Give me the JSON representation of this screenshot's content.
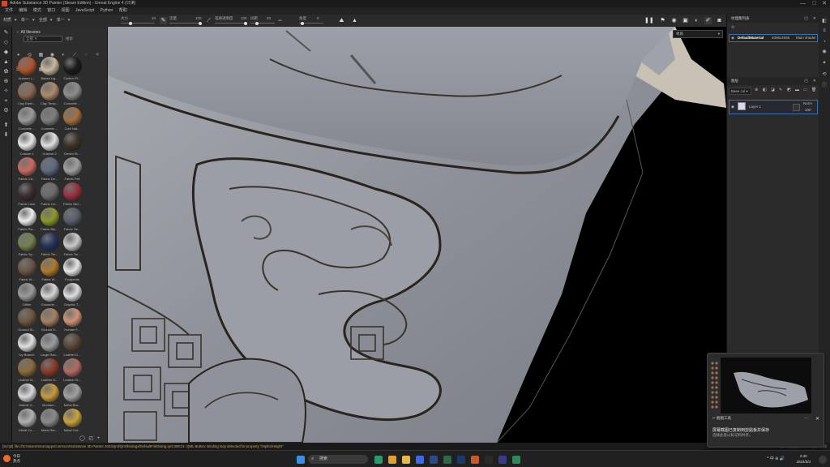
{
  "window": {
    "title": "Adobe Substance 3D Painter (Steam Edition) - Unreal Engine 4 (只读)",
    "controls": [
      "—",
      "□",
      "✕"
    ]
  },
  "menu": [
    "文件",
    "编辑",
    "模式",
    "窗口",
    "视图",
    "JavaScript",
    "Python",
    "帮助"
  ],
  "toolbar": [
    "材质",
    "▾",
    "单一",
    "▾",
    "全部",
    "▾",
    "单一",
    "▾",
    "全部",
    "▾"
  ],
  "properties": {
    "size_label": "大小",
    "size_value": "10",
    "flow_label": "流量",
    "flow_value": "100",
    "hardness_label": "笔刷透明度",
    "hardness_value": "100",
    "spacing_label": "间距",
    "spacing_value": "20",
    "angle_label": "角度",
    "angle_value": "0"
  },
  "assets": {
    "header": "All libraries",
    "search_placeholder": "搜索",
    "filter_tag": "全部",
    "items": [
      {
        "label": "Autumn L...",
        "color": "#b0542b"
      },
      {
        "label": "Baked Lig...",
        "color": "#c9b79c"
      },
      {
        "label": "Carbon Fi...",
        "color": "#1a1a1a"
      },
      {
        "label": "Clay Earth...",
        "color": "#8a6a52"
      },
      {
        "label": "Clay Temp...",
        "color": "#b08a6a"
      },
      {
        "label": "Concrete ...",
        "color": "#8d8d8d"
      },
      {
        "label": "Concrete ...",
        "color": "#9a9a9a"
      },
      {
        "label": "Concrete ...",
        "color": "#7e7e7e"
      },
      {
        "label": "Cork Nat...",
        "color": "#a2703f"
      },
      {
        "label": "Custom 1",
        "color": "#e8e8e8"
      },
      {
        "label": "Custom 2",
        "color": "#e0e0e0"
      },
      {
        "label": "Denim Ri...",
        "color": "#3d3427"
      },
      {
        "label": "Fabric Ca...",
        "color": "#c96a5e"
      },
      {
        "label": "Fabric De...",
        "color": "#5d6a80"
      },
      {
        "label": "Fabric Felt",
        "color": "#a0a0a0"
      },
      {
        "label": "Fabric Lace",
        "color": "#3a2f2f"
      },
      {
        "label": "Fabric Lin...",
        "color": "#6b6b6b"
      },
      {
        "label": "Fabric Mel...",
        "color": "#9a2f3e"
      },
      {
        "label": "Fabric Pla...",
        "color": "#ececec"
      },
      {
        "label": "Fabric Rip...",
        "color": "#8c9a2a"
      },
      {
        "label": "Fabric Se...",
        "color": "#585e6a"
      },
      {
        "label": "Fabric Sp...",
        "color": "#73804f"
      },
      {
        "label": "Fabric Ter...",
        "color": "#24325e"
      },
      {
        "label": "Fabric Tis...",
        "color": "#c9c9c9"
      },
      {
        "label": "Fabric W...",
        "color": "#6a5446"
      },
      {
        "label": "Fabric W...",
        "color": "#b07a2a"
      },
      {
        "label": "Footprints",
        "color": "#e6e6e6"
      },
      {
        "label": "Glitter",
        "color": "#9a9a9a"
      },
      {
        "label": "Gouache ...",
        "color": "#d5d5d5"
      },
      {
        "label": "Graphic T...",
        "color": "#dedede"
      },
      {
        "label": "Ground St...",
        "color": "#6d5640"
      },
      {
        "label": "Ground S...",
        "color": "#a58262"
      },
      {
        "label": "Human F...",
        "color": "#d09275"
      },
      {
        "label": "Ivy Branch",
        "color": "#e0e0e0"
      },
      {
        "label": "Large Ran...",
        "color": "#9c9c9c"
      },
      {
        "label": "Leather D...",
        "color": "#5a4536"
      },
      {
        "label": "Leather B...",
        "color": "#8a6a3a"
      },
      {
        "label": "Leather S...",
        "color": "#8a3a2a"
      },
      {
        "label": "Leather Sl...",
        "color": "#b06a60"
      },
      {
        "label": "Marble V...",
        "color": "#d8d8d8"
      },
      {
        "label": "Moufam...",
        "color": "#c69a3a"
      },
      {
        "label": "Metal Bra...",
        "color": "#a0a0a0"
      },
      {
        "label": "Metal Co...",
        "color": "#b0b0b0"
      },
      {
        "label": "Metal Ste...",
        "color": "#8a8a8a"
      },
      {
        "label": "Metal Gol...",
        "color": "#c8a23a"
      }
    ]
  },
  "viewport": {
    "shader_dropdown": "材质"
  },
  "texture_set_panel": {
    "title": "纹理集列表",
    "material_name": "DefaultMaterial",
    "resolution": "4096x4096",
    "shader": "Main shader"
  },
  "layers_panel": {
    "title": "图层",
    "channel": "Base col",
    "layer_name": "Layer 1",
    "blend_mode": "Norm",
    "opacity": "100"
  },
  "status_bar": {
    "message": "[Script] file:///D:/steam/steamapps/common/Substance 3D Painter 2023/qml/Qml/Dialogs/DefaultFileDialog.qml:308:21: QML Button: Binding loop detected for property \"implicitHeight\"",
    "right_text": "缓存磁盘使用: 未知 缓存: 未知"
  },
  "toast": {
    "app": "截图工具",
    "message_title": "屏幕截图已复制到剪贴板并保存",
    "message_body": "选择此处以标记和共享。",
    "more": "···",
    "close": "✕"
  },
  "taskbar": {
    "weather_temp": "今日",
    "weather_desc": "热点",
    "search_label": "搜索",
    "time": "2:40",
    "date": "2024/3/3",
    "tray": "^  中  ⊕  🔊",
    "icons": [
      {
        "name": "windows",
        "color": "#3a8ee6"
      },
      {
        "name": "edge",
        "color": "#2a9a6a"
      },
      {
        "name": "chrome",
        "color": "#e0a030"
      },
      {
        "name": "explorer",
        "color": "#e6b84a"
      },
      {
        "name": "store",
        "color": "#3a6ae6"
      },
      {
        "name": "photoshop",
        "color": "#2a4a8a"
      },
      {
        "name": "substance",
        "color": "#2a6a4a"
      },
      {
        "name": "steam",
        "color": "#1a3a6a"
      },
      {
        "name": "other",
        "color": "#c65a2a"
      },
      {
        "name": "terminal",
        "color": "#2a2a2a"
      },
      {
        "name": "unreal",
        "color": "#3a3a8a"
      },
      {
        "name": "painter",
        "color": "#2a8a5a"
      }
    ]
  }
}
